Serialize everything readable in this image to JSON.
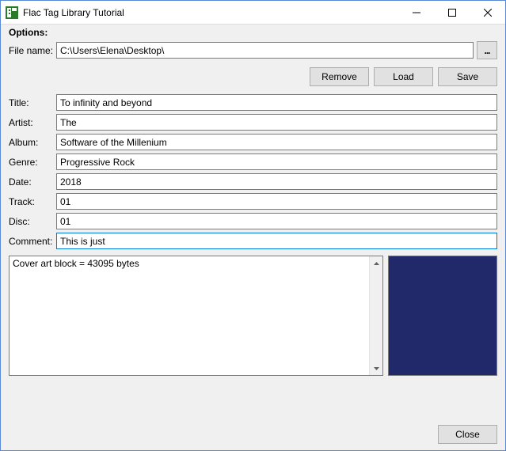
{
  "window": {
    "title": "Flac Tag Library Tutorial"
  },
  "options_label": "Options:",
  "file": {
    "label": "File name:",
    "value": "C:\\Users\\Elena\\Desktop\\",
    "browse_label": "..."
  },
  "actions": {
    "remove": "Remove",
    "load": "Load",
    "save": "Save"
  },
  "fields": {
    "title": {
      "label": "Title:",
      "value": "To infinity and beyond"
    },
    "artist": {
      "label": "Artist:",
      "value": "The"
    },
    "album": {
      "label": "Album:",
      "value": "Software of the Millenium"
    },
    "genre": {
      "label": "Genre:",
      "value": "Progressive Rock"
    },
    "date": {
      "label": "Date:",
      "value": "2018"
    },
    "track": {
      "label": "Track:",
      "value": "01"
    },
    "disc": {
      "label": "Disc:",
      "value": "01"
    },
    "comment": {
      "label": "Comment:",
      "value": "This is just"
    }
  },
  "cover": {
    "list_text": "Cover art block = 43095 bytes",
    "preview_color": "#21296b"
  },
  "footer": {
    "close": "Close"
  }
}
